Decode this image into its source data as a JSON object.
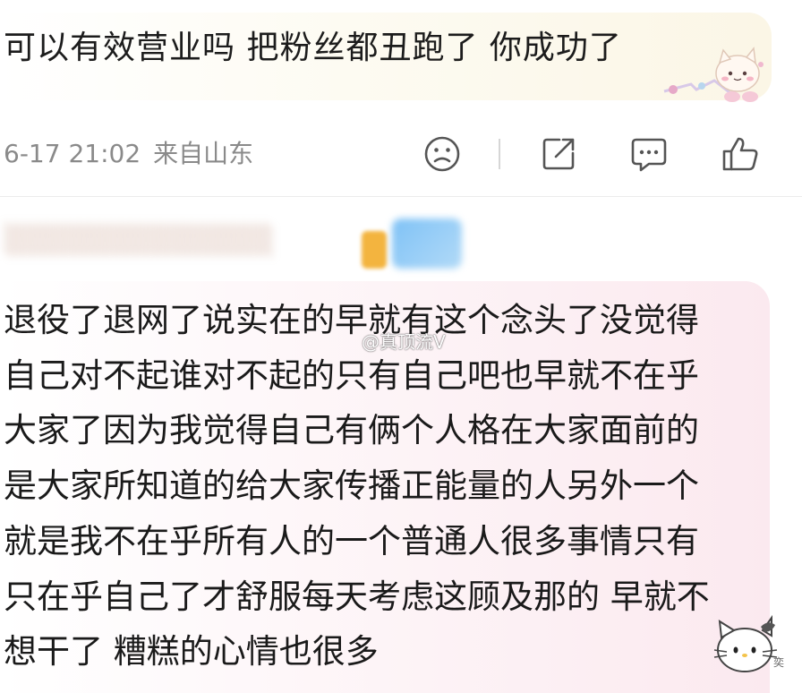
{
  "comment1": {
    "text": "可以有效营业吗 把粉丝都丑跑了 你成功了",
    "date": "6-17 21:02",
    "location": "来自山东",
    "bubble_color": "#fbf6e6"
  },
  "actions": [
    {
      "icon": "sad-face-icon"
    },
    {
      "icon": "share-icon"
    },
    {
      "icon": "comment-icon"
    },
    {
      "icon": "like-icon"
    }
  ],
  "comment2": {
    "username_blurred": "░░░░░░░░░░░░░",
    "text": "退役了退网了说实在的早就有这个念头了没觉得自己对不起谁对不起的只有自己吧也早就不在乎大家了因为我觉得自己有俩个人格在大家面前的是大家所知道的给大家传播正能量的人另外一个就是我不在乎所有人的一个普通人很多事情只有只在乎自己了才舒服每天考虑这顾及那的 早就不想干了 糟糕的心情也很多",
    "bubble_color": "#fbe9ef",
    "watermark": "@真顶流V"
  }
}
